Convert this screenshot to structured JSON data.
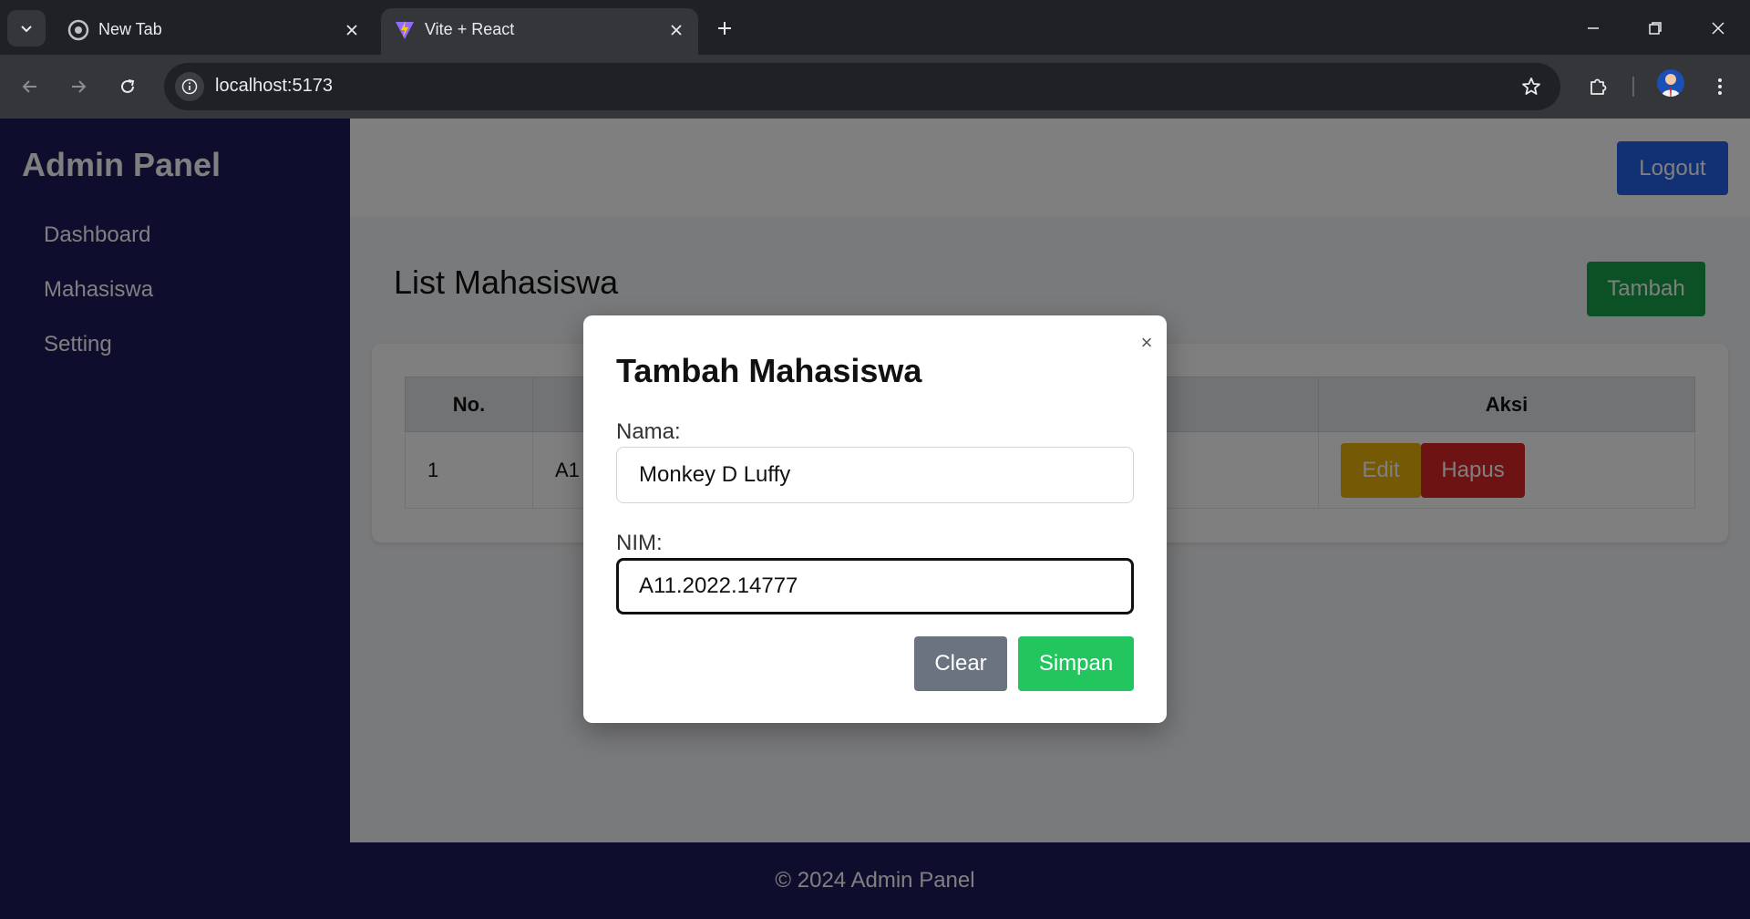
{
  "browser": {
    "tabs": [
      {
        "title": "New Tab",
        "favicon": "chrome-icon"
      },
      {
        "title": "Vite + React",
        "favicon": "vite-icon"
      }
    ],
    "url": "localhost:5173"
  },
  "app": {
    "brand": "Admin Panel",
    "nav": [
      "Dashboard",
      "Mahasiswa",
      "Setting"
    ],
    "logout_label": "Logout",
    "page_title": "List Mahasiswa",
    "add_label": "Tambah",
    "table": {
      "headers": [
        "No.",
        "Aksi"
      ],
      "rows": [
        {
          "no": "1",
          "nim_partial": "A1",
          "edit_label": "Edit",
          "delete_label": "Hapus"
        }
      ]
    },
    "footer": "© 2024 Admin Panel",
    "colors": {
      "sidebar": "#1e1b5c",
      "primary": "#2563eb",
      "success": "#16a34a",
      "warning": "#eab308",
      "danger": "#dc2626"
    }
  },
  "modal": {
    "title": "Tambah Mahasiswa",
    "close_glyph": "×",
    "nama_label": "Nama:",
    "nama_value": "Monkey D Luffy",
    "nim_label": "NIM:",
    "nim_value": "A11.2022.14777",
    "clear_label": "Clear",
    "save_label": "Simpan"
  }
}
